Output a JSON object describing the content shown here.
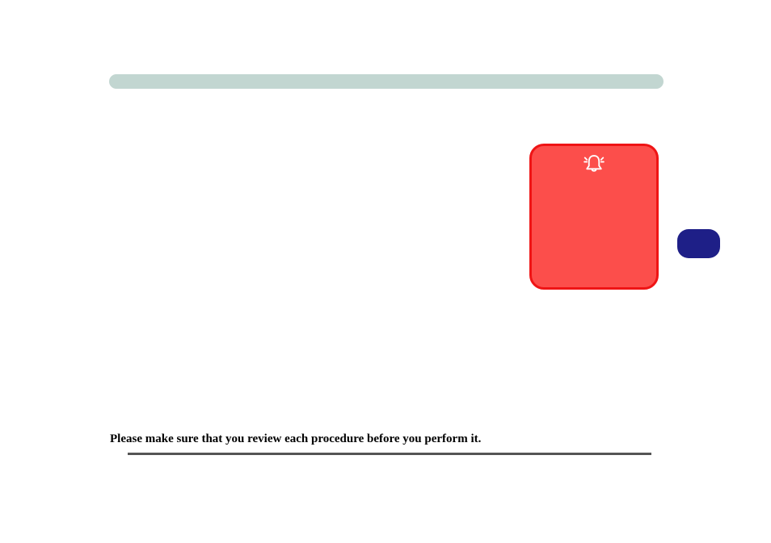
{
  "instruction": "Please make sure that you review each procedure before you perform it."
}
